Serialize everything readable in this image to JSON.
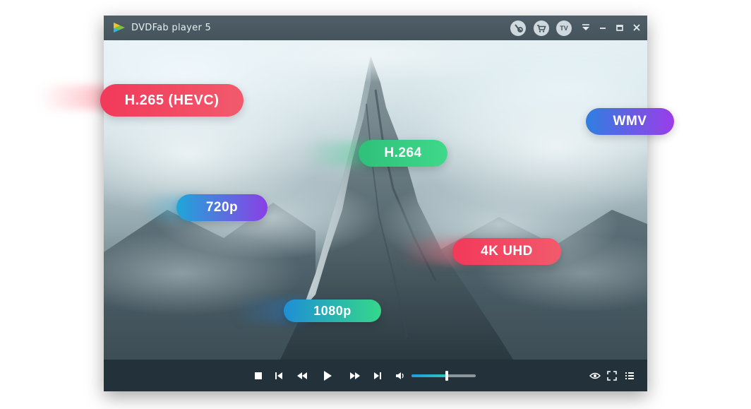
{
  "app": {
    "title": "DVDFab player 5"
  },
  "titlebar": {
    "tv_label": "TV"
  },
  "badges": [
    {
      "label": "H.265 (HEVC)"
    },
    {
      "label": "H.264"
    },
    {
      "label": "WMV"
    },
    {
      "label": "720p"
    },
    {
      "label": "4K UHD"
    },
    {
      "label": "1080p"
    }
  ],
  "volume": {
    "level": 0.55
  },
  "colors": {
    "accent": "#2fc7b8",
    "titlebar": "#4a5961",
    "controlbar": "#22313a"
  }
}
